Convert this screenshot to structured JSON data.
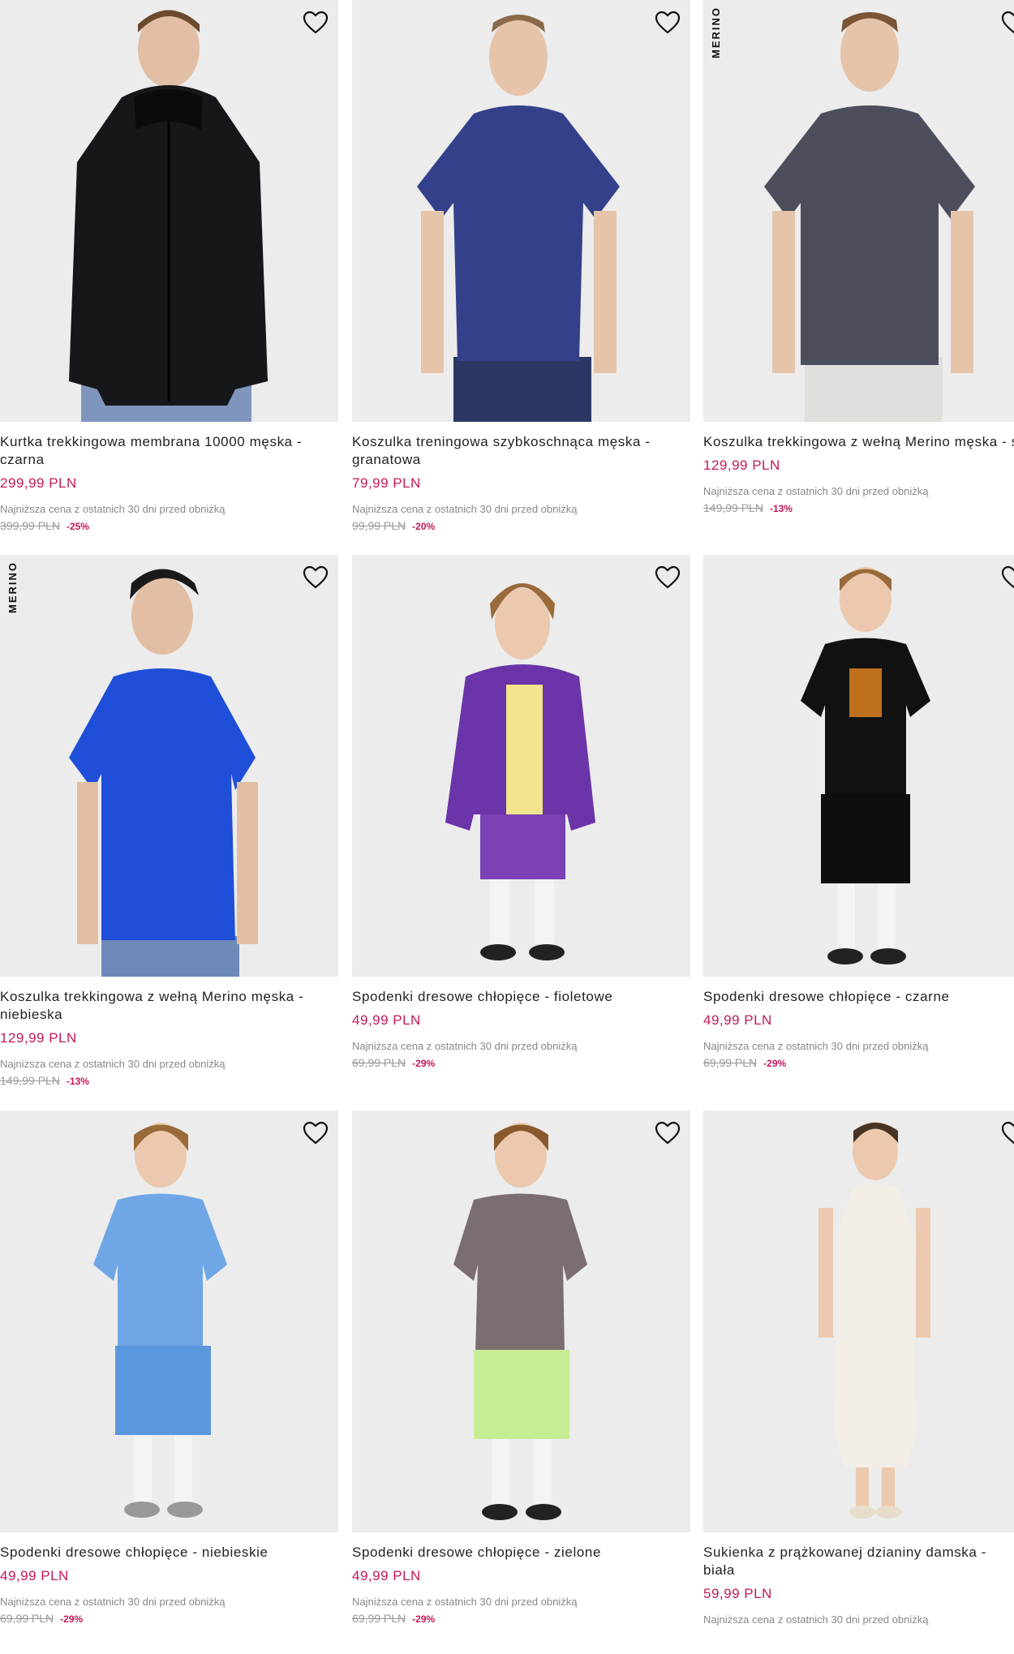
{
  "products": [
    {
      "name": "Kurtka trekkingowa membrana 10000 męska - czarna",
      "price": "299,99 PLN",
      "lowest": "Najniższa cena z ostatnich 30 dni przed obniżką",
      "old_price": "399,99 PLN",
      "discount": "-25%",
      "badge": ""
    },
    {
      "name": "Koszulka treningowa szybkoschnąca męska - granatowa",
      "price": "79,99 PLN",
      "lowest": "Najniższa cena z ostatnich 30 dni przed obniżką",
      "old_price": "99,99 PLN",
      "discount": "-20%",
      "badge": ""
    },
    {
      "name": "Koszulka trekkingowa z wełną Merino męska - szara",
      "price": "129,99 PLN",
      "lowest": "Najniższa cena z ostatnich 30 dni przed obniżką",
      "old_price": "149,99 PLN",
      "discount": "-13%",
      "badge": "MERINO"
    },
    {
      "name": "Koszulka trekkingowa z wełną Merino męska - niebieska",
      "price": "129,99 PLN",
      "lowest": "Najniższa cena z ostatnich 30 dni przed obniżką",
      "old_price": "149,99 PLN",
      "discount": "-13%",
      "badge": "MERINO"
    },
    {
      "name": "Spodenki dresowe chłopięce - fioletowe",
      "price": "49,99 PLN",
      "lowest": "Najniższa cena z ostatnich 30 dni przed obniżką",
      "old_price": "69,99 PLN",
      "discount": "-29%",
      "badge": ""
    },
    {
      "name": "Spodenki dresowe chłopięce - czarne",
      "price": "49,99 PLN",
      "lowest": "Najniższa cena z ostatnich 30 dni przed obniżką",
      "old_price": "69,99 PLN",
      "discount": "-29%",
      "badge": ""
    },
    {
      "name": "Spodenki dresowe chłopięce - niebieskie",
      "price": "49,99 PLN",
      "lowest": "Najniższa cena z ostatnich 30 dni przed obniżką",
      "old_price": "69,99 PLN",
      "discount": "-29%",
      "badge": ""
    },
    {
      "name": "Spodenki dresowe chłopięce - zielone",
      "price": "49,99 PLN",
      "lowest": "Najniższa cena z ostatnich 30 dni przed obniżką",
      "old_price": "69,99 PLN",
      "discount": "-29%",
      "badge": ""
    },
    {
      "name": "Sukienka z prążkowanej dzianiny damska - biała",
      "price": "59,99 PLN",
      "lowest": "Najniższa cena z ostatnich 30 dni przed obniżką",
      "old_price": "",
      "discount": "",
      "badge": ""
    }
  ],
  "icons": {
    "wishlist": "heart-outline-icon"
  },
  "colors": {
    "price": "#c2185b",
    "discount": "#c2185b",
    "photo_bg": "#ececec"
  }
}
